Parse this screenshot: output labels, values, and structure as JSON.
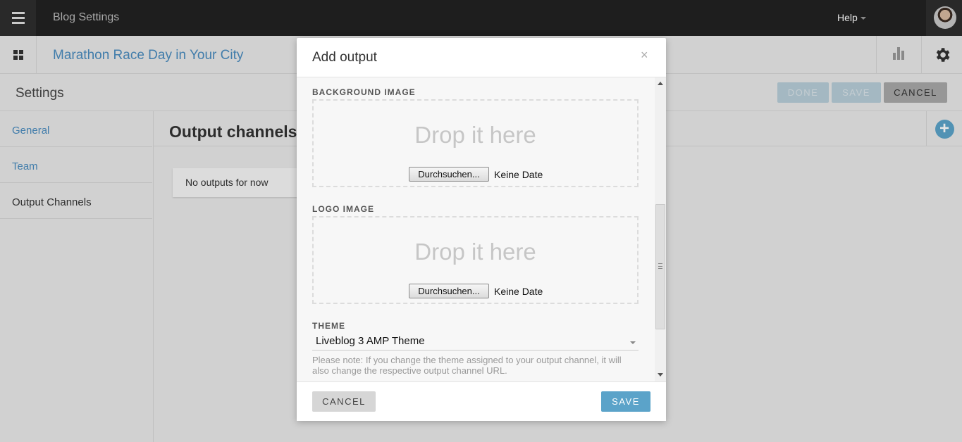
{
  "topbar": {
    "app_title": "Blog Settings",
    "help_label": "Help"
  },
  "subbar": {
    "blog_title": "Marathon Race Day in Your City"
  },
  "settings": {
    "title": "Settings",
    "done_label": "DONE",
    "save_label": "SAVE",
    "cancel_label": "CANCEL"
  },
  "sidebar": {
    "items": [
      {
        "label": "General"
      },
      {
        "label": "Team"
      },
      {
        "label": "Output Channels"
      }
    ]
  },
  "main": {
    "title": "Output channels",
    "empty_text": "No outputs for now"
  },
  "modal": {
    "title": "Add output",
    "close_glyph": "×",
    "background_label": "BACKGROUND IMAGE",
    "logo_label": "LOGO IMAGE",
    "drop_text": "Drop it here",
    "browse_label": "Durchsuchen...",
    "no_file_text": "Keine Date",
    "theme_label": "THEME",
    "theme_value": "Liveblog 3 AMP Theme",
    "theme_note": "Please note: If you change the theme assigned to your output channel, it will also change the respective output channel URL.",
    "cancel_label": "CANCEL",
    "save_label": "SAVE"
  },
  "colors": {
    "accent": "#5ba3c9",
    "link": "#4a8cbf",
    "topbar": "#222222"
  }
}
